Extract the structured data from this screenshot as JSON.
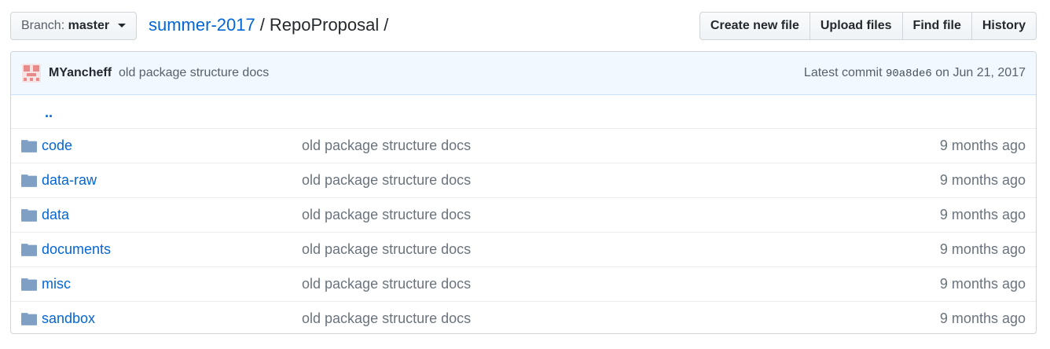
{
  "branch": {
    "prefix": "Branch:",
    "name": "master"
  },
  "breadcrumb": {
    "repo": "summer-2017",
    "separator": "/",
    "current": "RepoProposal",
    "trailing": "/"
  },
  "actions": {
    "create_new_file": "Create new file",
    "upload_files": "Upload files",
    "find_file": "Find file",
    "history": "History"
  },
  "commit": {
    "author": "MYancheff",
    "message": "old package structure docs",
    "prefix": "Latest commit",
    "sha": "90a8de6",
    "date_text": "on Jun 21, 2017"
  },
  "parent_dir": "..",
  "files": [
    {
      "name": "code",
      "message": "old package structure docs",
      "age": "9 months ago",
      "icon": "folder-icon"
    },
    {
      "name": "data-raw",
      "message": "old package structure docs",
      "age": "9 months ago",
      "icon": "folder-icon"
    },
    {
      "name": "data",
      "message": "old package structure docs",
      "age": "9 months ago",
      "icon": "folder-icon"
    },
    {
      "name": "documents",
      "message": "old package structure docs",
      "age": "9 months ago",
      "icon": "folder-icon"
    },
    {
      "name": "misc",
      "message": "old package structure docs",
      "age": "9 months ago",
      "icon": "folder-icon"
    },
    {
      "name": "sandbox",
      "message": "old package structure docs",
      "age": "9 months ago",
      "icon": "folder-icon"
    }
  ],
  "colors": {
    "link": "#0366d6",
    "folder": "#79b8ff",
    "avatar": "#e88a8a"
  }
}
